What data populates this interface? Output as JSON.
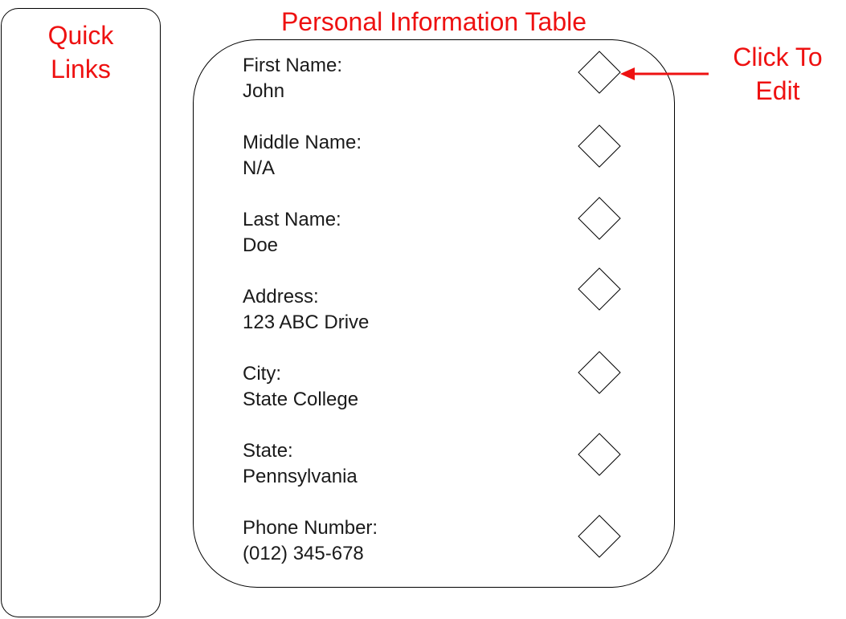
{
  "annotation_color": "#ee1111",
  "quick_links": {
    "title": "Quick\nLinks"
  },
  "page": {
    "title": "Personal Information Table"
  },
  "callout": {
    "label": "Click To\nEdit"
  },
  "fields": [
    {
      "label": "First Name:",
      "value": "John"
    },
    {
      "label": "Middle Name:",
      "value": "N/A"
    },
    {
      "label": "Last Name:",
      "value": "Doe"
    },
    {
      "label": "Address:",
      "value": "123 ABC Drive"
    },
    {
      "label": "City:",
      "value": "State College"
    },
    {
      "label": "State:",
      "value": "Pennsylvania"
    },
    {
      "label": "Phone Number:",
      "value": "(012) 345-678"
    }
  ],
  "edit_icon": "diamond-icon"
}
